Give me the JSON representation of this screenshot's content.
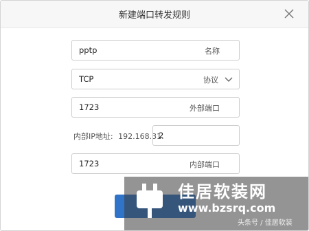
{
  "dialog": {
    "title": "新建端口转发规则"
  },
  "form": {
    "name_value": "pptp",
    "name_label": "名称",
    "protocol_value": "TCP",
    "protocol_label": "协议",
    "external_port_value": "1723",
    "external_port_label": "外部端口",
    "internal_ip_label": "内部IP地址:",
    "internal_ip_prefix": "192.168.31.",
    "internal_ip_suffix": "2",
    "internal_port_value": "1723",
    "internal_port_label": "内部端口"
  },
  "watermark": {
    "title": "佳居软装网",
    "url": "www.bzsrq.com",
    "source": "头条号 / 佳居软装"
  },
  "colors": {
    "primary_button": "#2f74c8",
    "border": "#cccccc"
  },
  "icons": {
    "close": "close-icon",
    "dropdown": "chevron-down-icon",
    "logo": "plug-icon"
  }
}
